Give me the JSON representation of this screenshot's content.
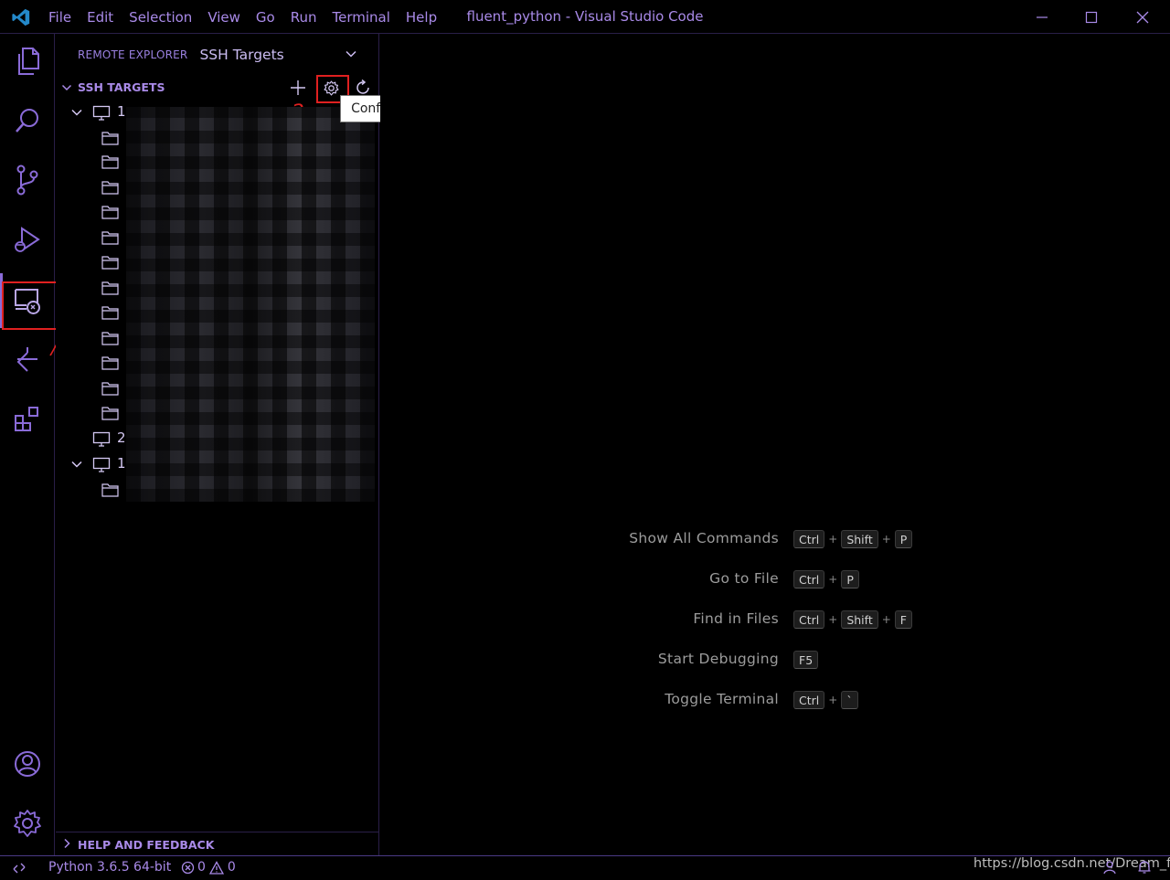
{
  "titlebar": {
    "menus": [
      "File",
      "Edit",
      "Selection",
      "View",
      "Go",
      "Run",
      "Terminal",
      "Help"
    ],
    "window_title": "fluent_python - Visual Studio Code"
  },
  "sidebar": {
    "title": "REMOTE EXPLORER",
    "selected_view": "SSH Targets",
    "section_title": "SSH TARGETS",
    "tooltip": "Configure",
    "hosts": [
      {
        "label": "1",
        "expanded": true
      },
      {
        "label": "2",
        "expanded": false
      },
      {
        "label": "1",
        "expanded": true
      }
    ],
    "help_section": "HELP AND FEEDBACK"
  },
  "annotations": {
    "step1": "/",
    "step2": "2"
  },
  "editor": {
    "shortcuts": [
      {
        "label": "Show All Commands",
        "keys": [
          "Ctrl",
          "Shift",
          "P"
        ]
      },
      {
        "label": "Go to File",
        "keys": [
          "Ctrl",
          "P"
        ]
      },
      {
        "label": "Find in Files",
        "keys": [
          "Ctrl",
          "Shift",
          "F"
        ]
      },
      {
        "label": "Start Debugging",
        "keys": [
          "F5"
        ]
      },
      {
        "label": "Toggle Terminal",
        "keys": [
          "Ctrl",
          "`"
        ]
      }
    ]
  },
  "statusbar": {
    "python": "Python 3.6.5 64-bit",
    "errors": "0",
    "warnings": "0",
    "watermark": "https://blog.csdn.net/Dream_f"
  },
  "colors": {
    "accent": "#8a6bd8",
    "annotation_red": "#e02020",
    "logo_blue": "#2489ca"
  }
}
